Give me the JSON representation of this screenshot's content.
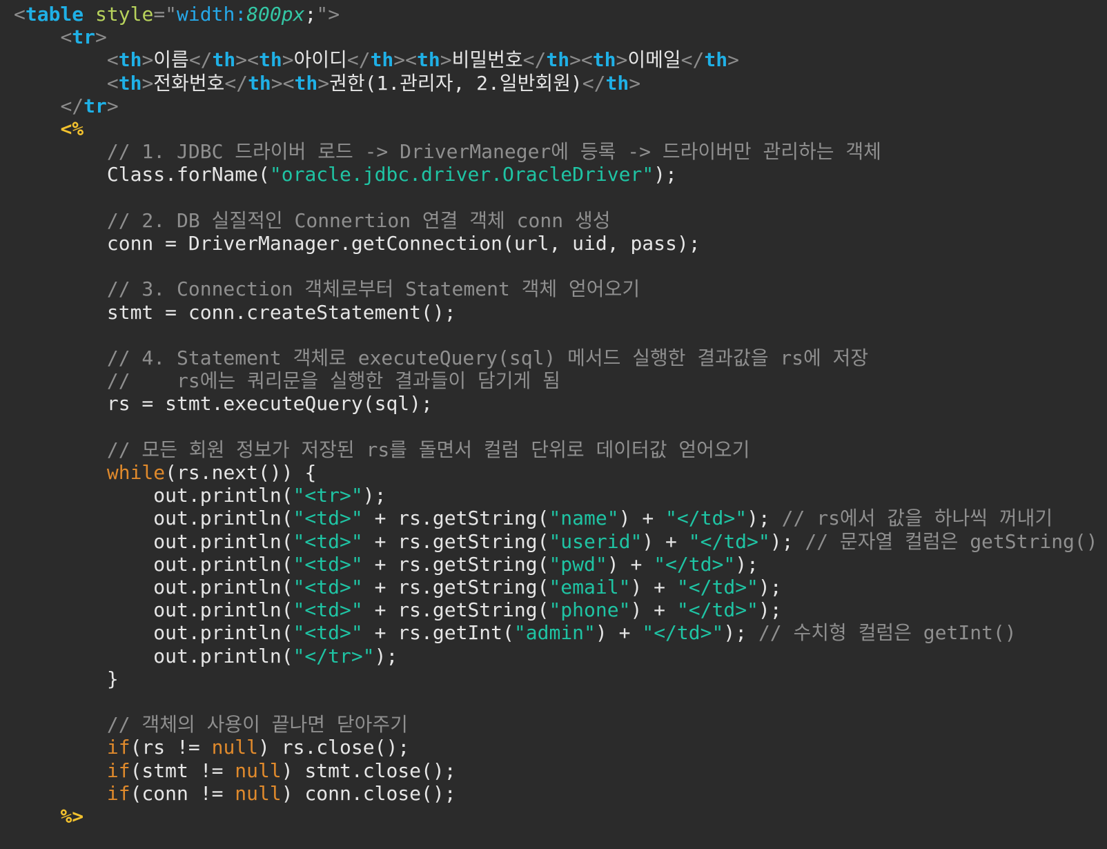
{
  "editor": {
    "language": "JSP",
    "theme": "dark",
    "colors": {
      "background": "#2b2b2b",
      "text": "#e6e6e6",
      "tag": "#1fb0e6",
      "attribute": "#b8d35c",
      "string": "#1fc4a4",
      "comment": "#8f8f8f",
      "keyword": "#e08a2c",
      "jsp_delimiter": "#f2c12e"
    },
    "lines": [
      [
        {
          "c": "b",
          "t": "<"
        },
        {
          "c": "k",
          "t": "table"
        },
        {
          "c": "t",
          "t": " "
        },
        {
          "c": "a",
          "t": "style"
        },
        {
          "c": "b",
          "t": "=\""
        },
        {
          "c": "av",
          "t": "width:"
        },
        {
          "c": "ai",
          "t": "800px"
        },
        {
          "c": "t",
          "t": ";"
        },
        {
          "c": "b",
          "t": "\">"
        }
      ],
      [
        {
          "c": "t",
          "t": "    "
        },
        {
          "c": "b",
          "t": "<"
        },
        {
          "c": "k",
          "t": "tr"
        },
        {
          "c": "b",
          "t": ">"
        }
      ],
      [
        {
          "c": "t",
          "t": "        "
        },
        {
          "c": "b",
          "t": "<"
        },
        {
          "c": "k",
          "t": "th"
        },
        {
          "c": "b",
          "t": ">"
        },
        {
          "c": "t",
          "t": "이름"
        },
        {
          "c": "b",
          "t": "</"
        },
        {
          "c": "k",
          "t": "th"
        },
        {
          "c": "b",
          "t": "><"
        },
        {
          "c": "k",
          "t": "th"
        },
        {
          "c": "b",
          "t": ">"
        },
        {
          "c": "t",
          "t": "아이디"
        },
        {
          "c": "b",
          "t": "</"
        },
        {
          "c": "k",
          "t": "th"
        },
        {
          "c": "b",
          "t": "><"
        },
        {
          "c": "k",
          "t": "th"
        },
        {
          "c": "b",
          "t": ">"
        },
        {
          "c": "t",
          "t": "비밀번호"
        },
        {
          "c": "b",
          "t": "</"
        },
        {
          "c": "k",
          "t": "th"
        },
        {
          "c": "b",
          "t": "><"
        },
        {
          "c": "k",
          "t": "th"
        },
        {
          "c": "b",
          "t": ">"
        },
        {
          "c": "t",
          "t": "이메일"
        },
        {
          "c": "b",
          "t": "</"
        },
        {
          "c": "k",
          "t": "th"
        },
        {
          "c": "b",
          "t": ">"
        }
      ],
      [
        {
          "c": "t",
          "t": "        "
        },
        {
          "c": "b",
          "t": "<"
        },
        {
          "c": "k",
          "t": "th"
        },
        {
          "c": "b",
          "t": ">"
        },
        {
          "c": "t",
          "t": "전화번호"
        },
        {
          "c": "b",
          "t": "</"
        },
        {
          "c": "k",
          "t": "th"
        },
        {
          "c": "b",
          "t": "><"
        },
        {
          "c": "k",
          "t": "th"
        },
        {
          "c": "b",
          "t": ">"
        },
        {
          "c": "t",
          "t": "권한(1.관리자, 2.일반회원)"
        },
        {
          "c": "b",
          "t": "</"
        },
        {
          "c": "k",
          "t": "th"
        },
        {
          "c": "b",
          "t": ">"
        }
      ],
      [
        {
          "c": "t",
          "t": "    "
        },
        {
          "c": "b",
          "t": "</"
        },
        {
          "c": "k",
          "t": "tr"
        },
        {
          "c": "b",
          "t": ">"
        }
      ],
      [
        {
          "c": "t",
          "t": "    "
        },
        {
          "c": "j",
          "t": "<%"
        }
      ],
      [
        {
          "c": "t",
          "t": "        "
        },
        {
          "c": "c",
          "t": "// 1. JDBC 드라이버 로드 -> DriverManeger에 등록 -> 드라이버만 관리하는 객체"
        }
      ],
      [
        {
          "c": "t",
          "t": "        Class.forName("
        },
        {
          "c": "s",
          "t": "\"oracle.jdbc.driver.OracleDriver\""
        },
        {
          "c": "t",
          "t": ");"
        }
      ],
      [],
      [
        {
          "c": "t",
          "t": "        "
        },
        {
          "c": "c",
          "t": "// 2. DB 실질적인 Connertion 연결 객체 conn 생성"
        }
      ],
      [
        {
          "c": "t",
          "t": "        conn = DriverManager.getConnection(url, uid, pass);"
        }
      ],
      [],
      [
        {
          "c": "t",
          "t": "        "
        },
        {
          "c": "c",
          "t": "// 3. Connection 객체로부터 Statement 객체 얻어오기"
        }
      ],
      [
        {
          "c": "t",
          "t": "        stmt = conn.createStatement();"
        }
      ],
      [],
      [
        {
          "c": "t",
          "t": "        "
        },
        {
          "c": "c",
          "t": "// 4. Statement 객체로 executeQuery(sql) 메서드 실행한 결과값을 rs에 저장"
        }
      ],
      [
        {
          "c": "t",
          "t": "        "
        },
        {
          "c": "c",
          "t": "//    rs에는 쿼리문을 실행한 결과들이 담기게 됨"
        }
      ],
      [
        {
          "c": "t",
          "t": "        rs = stmt.executeQuery(sql);"
        }
      ],
      [],
      [
        {
          "c": "t",
          "t": "        "
        },
        {
          "c": "c",
          "t": "// 모든 회원 정보가 저장된 rs를 돌면서 컬럼 단위로 데이터값 얻어오기"
        }
      ],
      [
        {
          "c": "t",
          "t": "        "
        },
        {
          "c": "o",
          "t": "while"
        },
        {
          "c": "t",
          "t": "(rs.next()) {"
        }
      ],
      [
        {
          "c": "t",
          "t": "            out.println("
        },
        {
          "c": "s",
          "t": "\"<tr>\""
        },
        {
          "c": "t",
          "t": ");"
        }
      ],
      [
        {
          "c": "t",
          "t": "            out.println("
        },
        {
          "c": "s",
          "t": "\"<td>\""
        },
        {
          "c": "t",
          "t": " + rs.getString("
        },
        {
          "c": "s",
          "t": "\"name\""
        },
        {
          "c": "t",
          "t": ") + "
        },
        {
          "c": "s",
          "t": "\"</td>\""
        },
        {
          "c": "t",
          "t": "); "
        },
        {
          "c": "c",
          "t": "// rs에서 값을 하나씩 꺼내기"
        }
      ],
      [
        {
          "c": "t",
          "t": "            out.println("
        },
        {
          "c": "s",
          "t": "\"<td>\""
        },
        {
          "c": "t",
          "t": " + rs.getString("
        },
        {
          "c": "s",
          "t": "\"userid\""
        },
        {
          "c": "t",
          "t": ") + "
        },
        {
          "c": "s",
          "t": "\"</td>\""
        },
        {
          "c": "t",
          "t": "); "
        },
        {
          "c": "c",
          "t": "// 문자열 컬럼은 getString()"
        }
      ],
      [
        {
          "c": "t",
          "t": "            out.println("
        },
        {
          "c": "s",
          "t": "\"<td>\""
        },
        {
          "c": "t",
          "t": " + rs.getString("
        },
        {
          "c": "s",
          "t": "\"pwd\""
        },
        {
          "c": "t",
          "t": ") + "
        },
        {
          "c": "s",
          "t": "\"</td>\""
        },
        {
          "c": "t",
          "t": ");"
        }
      ],
      [
        {
          "c": "t",
          "t": "            out.println("
        },
        {
          "c": "s",
          "t": "\"<td>\""
        },
        {
          "c": "t",
          "t": " + rs.getString("
        },
        {
          "c": "s",
          "t": "\"email\""
        },
        {
          "c": "t",
          "t": ") + "
        },
        {
          "c": "s",
          "t": "\"</td>\""
        },
        {
          "c": "t",
          "t": ");"
        }
      ],
      [
        {
          "c": "t",
          "t": "            out.println("
        },
        {
          "c": "s",
          "t": "\"<td>\""
        },
        {
          "c": "t",
          "t": " + rs.getString("
        },
        {
          "c": "s",
          "t": "\"phone\""
        },
        {
          "c": "t",
          "t": ") + "
        },
        {
          "c": "s",
          "t": "\"</td>\""
        },
        {
          "c": "t",
          "t": ");"
        }
      ],
      [
        {
          "c": "t",
          "t": "            out.println("
        },
        {
          "c": "s",
          "t": "\"<td>\""
        },
        {
          "c": "t",
          "t": " + rs.getInt("
        },
        {
          "c": "s",
          "t": "\"admin\""
        },
        {
          "c": "t",
          "t": ") + "
        },
        {
          "c": "s",
          "t": "\"</td>\""
        },
        {
          "c": "t",
          "t": "); "
        },
        {
          "c": "c",
          "t": "// 수치형 컬럼은 getInt()"
        }
      ],
      [
        {
          "c": "t",
          "t": "            out.println("
        },
        {
          "c": "s",
          "t": "\"</tr>\""
        },
        {
          "c": "t",
          "t": ");"
        }
      ],
      [
        {
          "c": "t",
          "t": "        }"
        }
      ],
      [],
      [
        {
          "c": "t",
          "t": "        "
        },
        {
          "c": "c",
          "t": "// 객체의 사용이 끝나면 닫아주기"
        }
      ],
      [
        {
          "c": "t",
          "t": "        "
        },
        {
          "c": "o",
          "t": "if"
        },
        {
          "c": "t",
          "t": "(rs != "
        },
        {
          "c": "o",
          "t": "null"
        },
        {
          "c": "t",
          "t": ") rs.close();"
        }
      ],
      [
        {
          "c": "t",
          "t": "        "
        },
        {
          "c": "o",
          "t": "if"
        },
        {
          "c": "t",
          "t": "(stmt != "
        },
        {
          "c": "o",
          "t": "null"
        },
        {
          "c": "t",
          "t": ") stmt.close();"
        }
      ],
      [
        {
          "c": "t",
          "t": "        "
        },
        {
          "c": "o",
          "t": "if"
        },
        {
          "c": "t",
          "t": "(conn != "
        },
        {
          "c": "o",
          "t": "null"
        },
        {
          "c": "t",
          "t": ") conn.close();"
        }
      ],
      [
        {
          "c": "t",
          "t": "    "
        },
        {
          "c": "j",
          "t": "%>"
        }
      ]
    ]
  }
}
